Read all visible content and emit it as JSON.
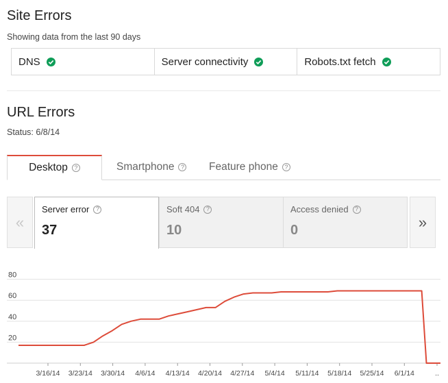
{
  "site_errors": {
    "title": "Site Errors",
    "subtitle": "Showing data from the last 90 days",
    "items": [
      {
        "label": "DNS",
        "status": "ok"
      },
      {
        "label": "Server connectivity",
        "status": "ok"
      },
      {
        "label": "Robots.txt fetch",
        "status": "ok"
      }
    ]
  },
  "url_errors": {
    "title": "URL Errors",
    "status": "Status: 6/8/14",
    "tabs": [
      {
        "label": "Desktop",
        "active": true
      },
      {
        "label": "Smartphone",
        "active": false
      },
      {
        "label": "Feature phone",
        "active": false
      }
    ],
    "metrics": [
      {
        "label": "Server error",
        "value": "37",
        "active": true
      },
      {
        "label": "Soft 404",
        "value": "10",
        "active": false
      },
      {
        "label": "Access denied",
        "value": "0",
        "active": false
      }
    ],
    "nav": {
      "prev": "«",
      "next": "»"
    }
  },
  "colors": {
    "accent": "#dd4b39",
    "ok": "#0f9d58",
    "line": "#dd4b39"
  },
  "chart_data": {
    "type": "line",
    "series": [
      {
        "color": "#dd4b39",
        "x": [
          0,
          4,
          8,
          12,
          14,
          16,
          18,
          20,
          22,
          24,
          26,
          28,
          30,
          32,
          34,
          36,
          38,
          40,
          42,
          44,
          46,
          48,
          50,
          52,
          54,
          56,
          58,
          60,
          62,
          64,
          66,
          68,
          70,
          72,
          74,
          76,
          78,
          80,
          82,
          84,
          86,
          87,
          88,
          89,
          90
        ],
        "values": [
          17,
          17,
          17,
          17,
          17,
          20,
          26,
          31,
          37,
          40,
          42,
          42,
          42,
          45,
          47,
          49,
          51,
          53,
          53,
          59,
          63,
          66,
          67,
          67,
          67,
          68,
          68,
          68,
          68,
          68,
          68,
          69,
          69,
          69,
          69,
          69,
          69,
          69,
          69,
          69,
          69,
          0,
          0,
          0,
          0
        ]
      }
    ],
    "y_ticks": [
      20,
      40,
      60,
      80
    ],
    "x_tick_labels": [
      "3/16/14",
      "3/23/14",
      "3/30/14",
      "4/6/14",
      "4/13/14",
      "4/20/14",
      "4/27/14",
      "5/4/14",
      "5/11/14",
      "5/18/14",
      "5/25/14",
      "6/1/14",
      ".."
    ],
    "ylim": [
      0,
      85
    ],
    "grid": true
  }
}
